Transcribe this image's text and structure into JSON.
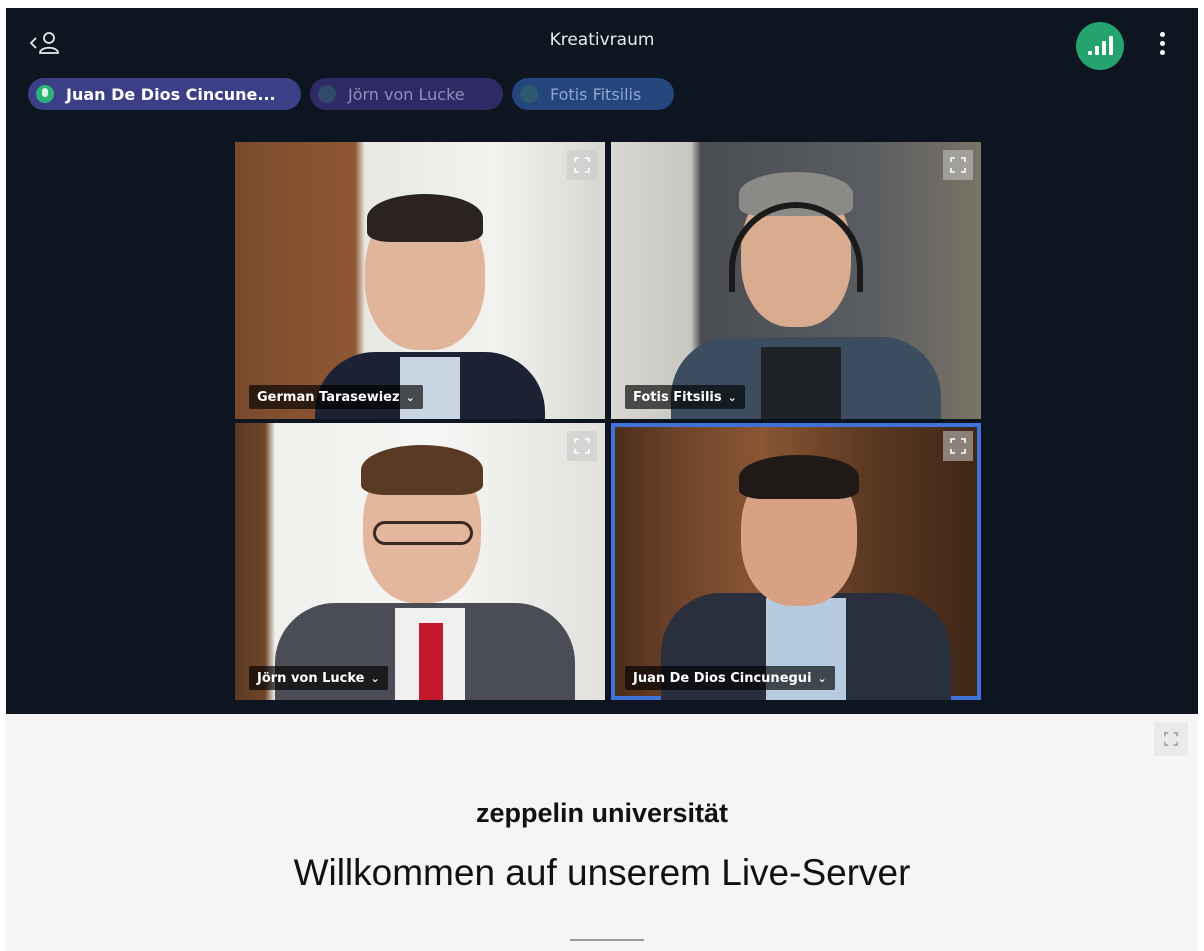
{
  "room": {
    "title": "Kreativraum"
  },
  "participant_chips": [
    {
      "name": "Juan De Dios Cincune...",
      "state": "speaking"
    },
    {
      "name": "Jörn von Lucke",
      "state": "muted"
    },
    {
      "name": "Fotis Fitsilis",
      "state": "muted"
    }
  ],
  "video_tiles": [
    {
      "name": "German Tarasewiez",
      "caret": "⌄"
    },
    {
      "name": "Fotis Fitsilis",
      "caret": "⌄"
    },
    {
      "name": "Jörn von Lucke",
      "caret": "⌄"
    },
    {
      "name": "Juan De Dios Cincunegui",
      "caret": "⌄"
    }
  ],
  "banner": {
    "brand": "zeppelin universität",
    "welcome": "Willkommen auf unserem Live-Server"
  },
  "icons": {
    "back": "back-user-icon",
    "signal": "signal-strength-icon",
    "more": "more-vertical-icon",
    "expand": "expand-icon"
  },
  "colors": {
    "call_background": "#0d1521",
    "signal_button": "#25a36f",
    "active_speaker_border": "#3f73d8",
    "chip_active": "#3b3f86",
    "chip_muted_1": "#2f2a66",
    "chip_muted_2": "#25467d"
  }
}
